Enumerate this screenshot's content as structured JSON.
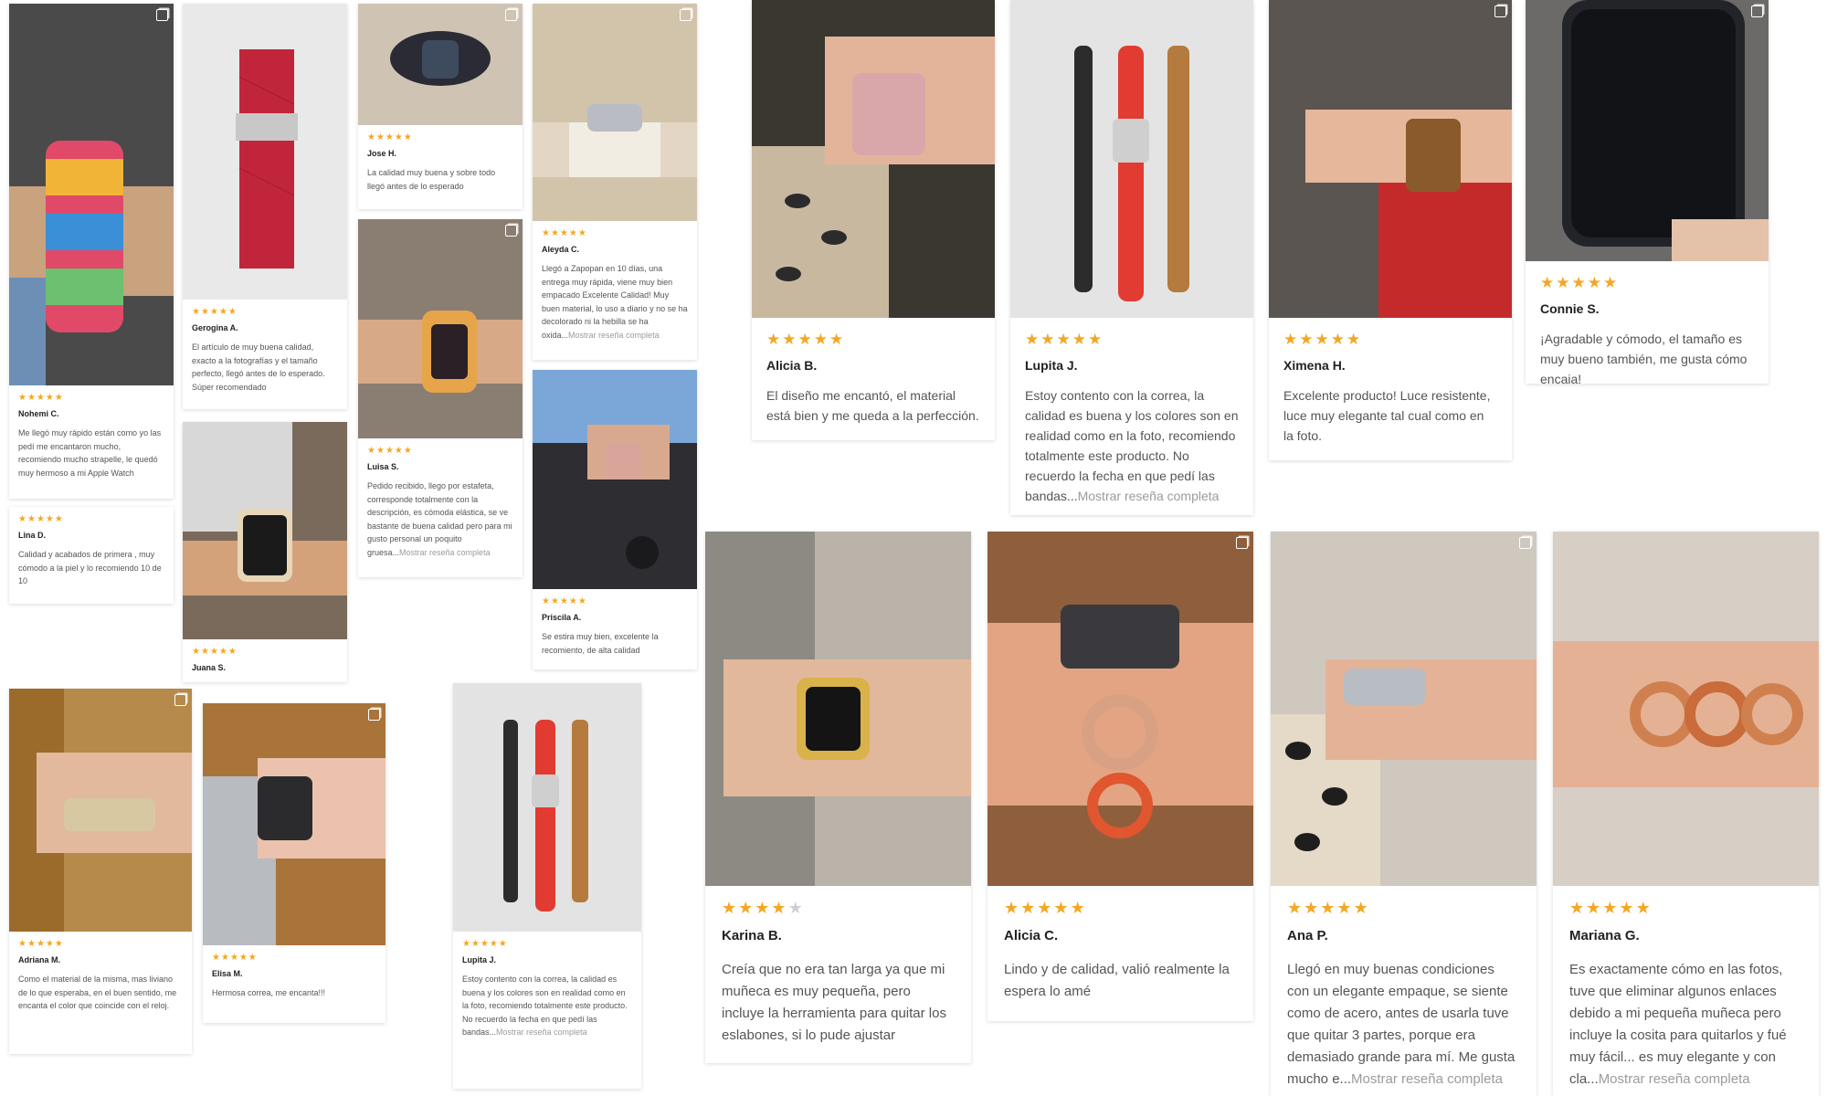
{
  "reviews_small": [
    {
      "name": "Nohemi C.",
      "rating": 5,
      "text": "Me llegó muy rápido están como yo las pedí me encantaron mucho, recomiendo mucho strapelle, le quedó muy hermoso a mi Apple Watch",
      "more": ""
    },
    {
      "name": "Lina D.",
      "rating": 5,
      "text": "Calidad y acabados de primera , muy cómodo a la piel y lo recomiendo 10 de 10",
      "more": ""
    },
    {
      "name": "Gerogina A.",
      "rating": 5,
      "text": "El artículo de muy buena calidad, exacto a la fotografías y el tamaño perfecto, llegó antes de lo esperado. Súper recomendado",
      "more": ""
    },
    {
      "name": "Juana S.",
      "rating": 5,
      "text": "",
      "more": ""
    },
    {
      "name": "Jose H.",
      "rating": 5,
      "text": "La calidad muy buena y sobre todo llegó antes de lo esperado",
      "more": ""
    },
    {
      "name": "Luisa S.",
      "rating": 5,
      "text": "Pedido recibido, llego por estafeta, corresponde totalmente con la descripción, es cómoda elástica, se ve bastante de buena calidad pero para mi gusto personal un poquito gruesa...",
      "more": "Mostrar reseña completa"
    },
    {
      "name": "Aleyda C.",
      "rating": 5,
      "text": "Llegó a Zapopan en 10 días, una entrega muy rápida, viene muy bien empacado Excelente Calidad! Muy buen material, lo uso a diario y no se ha decolorado ni la hebilla se ha oxida...",
      "more": "Mostrar reseña completa"
    },
    {
      "name": "Priscila A.",
      "rating": 5,
      "text": "Se estira muy bien, excelente la recomiento, de alta calidad",
      "more": ""
    },
    {
      "name": "Adriana M.",
      "rating": 5,
      "text": "Como el material de la misma, mas liviano de lo que esperaba, en el buen sentido, me encanta el color que coincide con el reloj.",
      "more": ""
    },
    {
      "name": "Elisa M.",
      "rating": 5,
      "text": "Hermosa correa, me encanta!!!",
      "more": ""
    },
    {
      "name": "Lupita J.",
      "rating": 5,
      "text": "Estoy contento con la correa, la calidad es buena y los colores son en realidad como en la foto, recomiendo totalmente este producto. No recuerdo la fecha en que pedí las bandas...",
      "more": "Mostrar reseña completa"
    }
  ],
  "reviews_large": [
    {
      "name": "Alicia B.",
      "rating": 5,
      "text": "El diseño me encantó, el material está bien y me queda a la perfección.",
      "more": ""
    },
    {
      "name": "Lupita J.",
      "rating": 5,
      "text": "Estoy contento con la correa, la calidad es buena y los colores son en realidad como en la foto, recomiendo totalmente este producto. No recuerdo la fecha en que pedí las bandas...",
      "more": "Mostrar reseña completa"
    },
    {
      "name": "Ximena H.",
      "rating": 5,
      "text": "Excelente producto! Luce resistente, luce muy elegante tal cual como en la foto.",
      "more": ""
    },
    {
      "name": "Connie S.",
      "rating": 5,
      "text": "¡Agradable y cómodo, el tamaño es muy bueno también, me gusta cómo encaja!",
      "more": ""
    }
  ],
  "reviews_xl": [
    {
      "name": "Karina B.",
      "rating": 4,
      "text": "Creía que no era tan larga ya que mi muñeca es muy pequeña, pero incluye la herramienta para quitar los eslabones, si lo pude ajustar",
      "more": ""
    },
    {
      "name": "Alicia C.",
      "rating": 5,
      "text": "Lindo y de calidad, valió realmente la espera lo amé",
      "more": ""
    },
    {
      "name": "Ana P.",
      "rating": 5,
      "text": "Llegó en muy buenas condiciones con un elegante empaque, se siente como de acero, antes de usarla tuve que quitar 3 partes, porque era demasiado grande para mí. Me gusta mucho e...",
      "more": "Mostrar reseña completa"
    },
    {
      "name": "Mariana G.",
      "rating": 5,
      "text": "Es exactamente cómo en las fotos, tuve que eliminar algunos enlaces debido a mi pequeña muñeca pero incluye la cosita para quitarlos y fué muy fácil... es muy elegante y con cla...",
      "more": "Mostrar reseña completa"
    }
  ],
  "colors": {
    "star": "#f5a623",
    "star_off": "#cfcfcf",
    "more_link": "#9b9b9b"
  },
  "icons": {
    "multi_photo": "multi-photo-icon",
    "star": "star-icon"
  }
}
